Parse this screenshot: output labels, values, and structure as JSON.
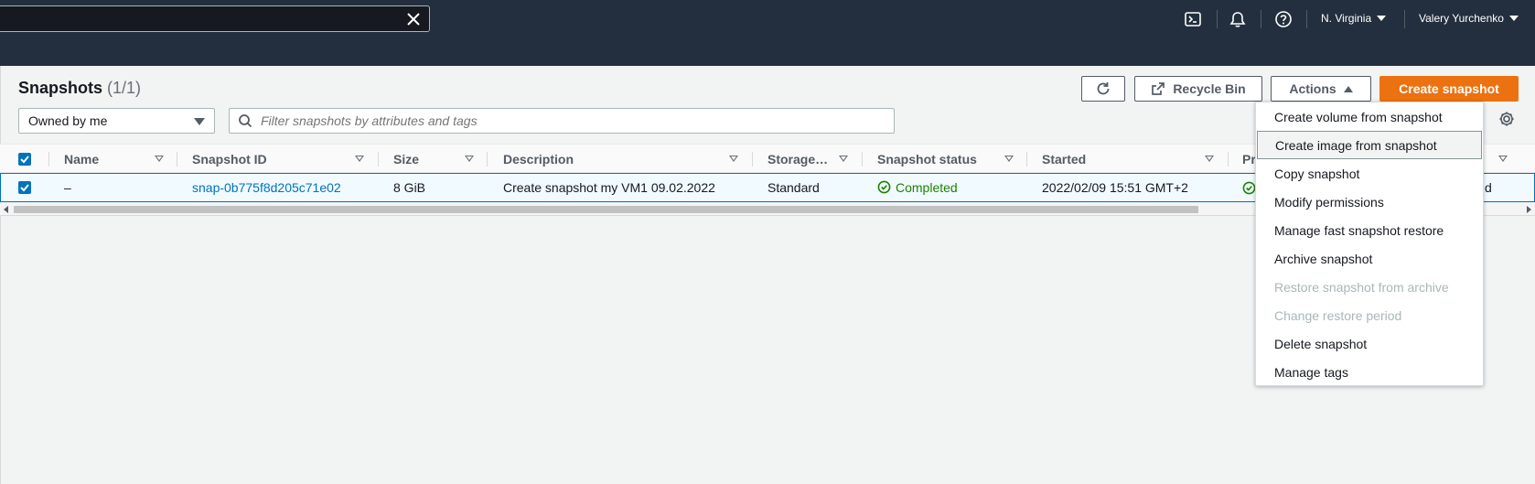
{
  "topnav": {
    "region": "N. Virginia",
    "user": "Valery Yurchenko"
  },
  "header": {
    "title": "Snapshots",
    "count": "(1/1)",
    "refresh_label": "",
    "recycle_bin_label": "Recycle Bin",
    "actions_label": "Actions",
    "create_label": "Create snapshot"
  },
  "filters": {
    "owner_select": "Owned by me",
    "search_placeholder": "Filter snapshots by attributes and tags"
  },
  "table": {
    "columns": [
      "Name",
      "Snapshot ID",
      "Size",
      "Description",
      "Storage…",
      "Snapshot status",
      "Started",
      "Pr"
    ],
    "rows": [
      {
        "selected": true,
        "name": "–",
        "snapshot_id": "snap-0b775f8d205c71e02",
        "size": "8 GiB",
        "description": "Create snapshot my VM1 09.02.2022",
        "storage": "Standard",
        "status": "Completed",
        "started": "2022/02/09 15:51 GMT+2",
        "progress_tail": "d"
      }
    ]
  },
  "actions_menu": {
    "items": [
      {
        "label": "Create volume from snapshot",
        "enabled": true
      },
      {
        "label": "Create image from snapshot",
        "enabled": true,
        "highlighted": true
      },
      {
        "label": "Copy snapshot",
        "enabled": true
      },
      {
        "label": "Modify permissions",
        "enabled": true
      },
      {
        "label": "Manage fast snapshot restore",
        "enabled": true
      },
      {
        "label": "Archive snapshot",
        "enabled": true
      },
      {
        "label": "Restore snapshot from archive",
        "enabled": false
      },
      {
        "label": "Change restore period",
        "enabled": false
      },
      {
        "label": "Delete snapshot",
        "enabled": true
      },
      {
        "label": "Manage tags",
        "enabled": true
      }
    ]
  },
  "colors": {
    "nav_bg": "#232f3e",
    "primary": "#ec7211",
    "link": "#0073bb",
    "success": "#1d8102"
  },
  "icons": [
    "close-icon",
    "cloudshell-icon",
    "bell-icon",
    "help-icon",
    "refresh-icon",
    "external-link-icon",
    "search-icon",
    "gear-icon",
    "check-circle-icon"
  ]
}
